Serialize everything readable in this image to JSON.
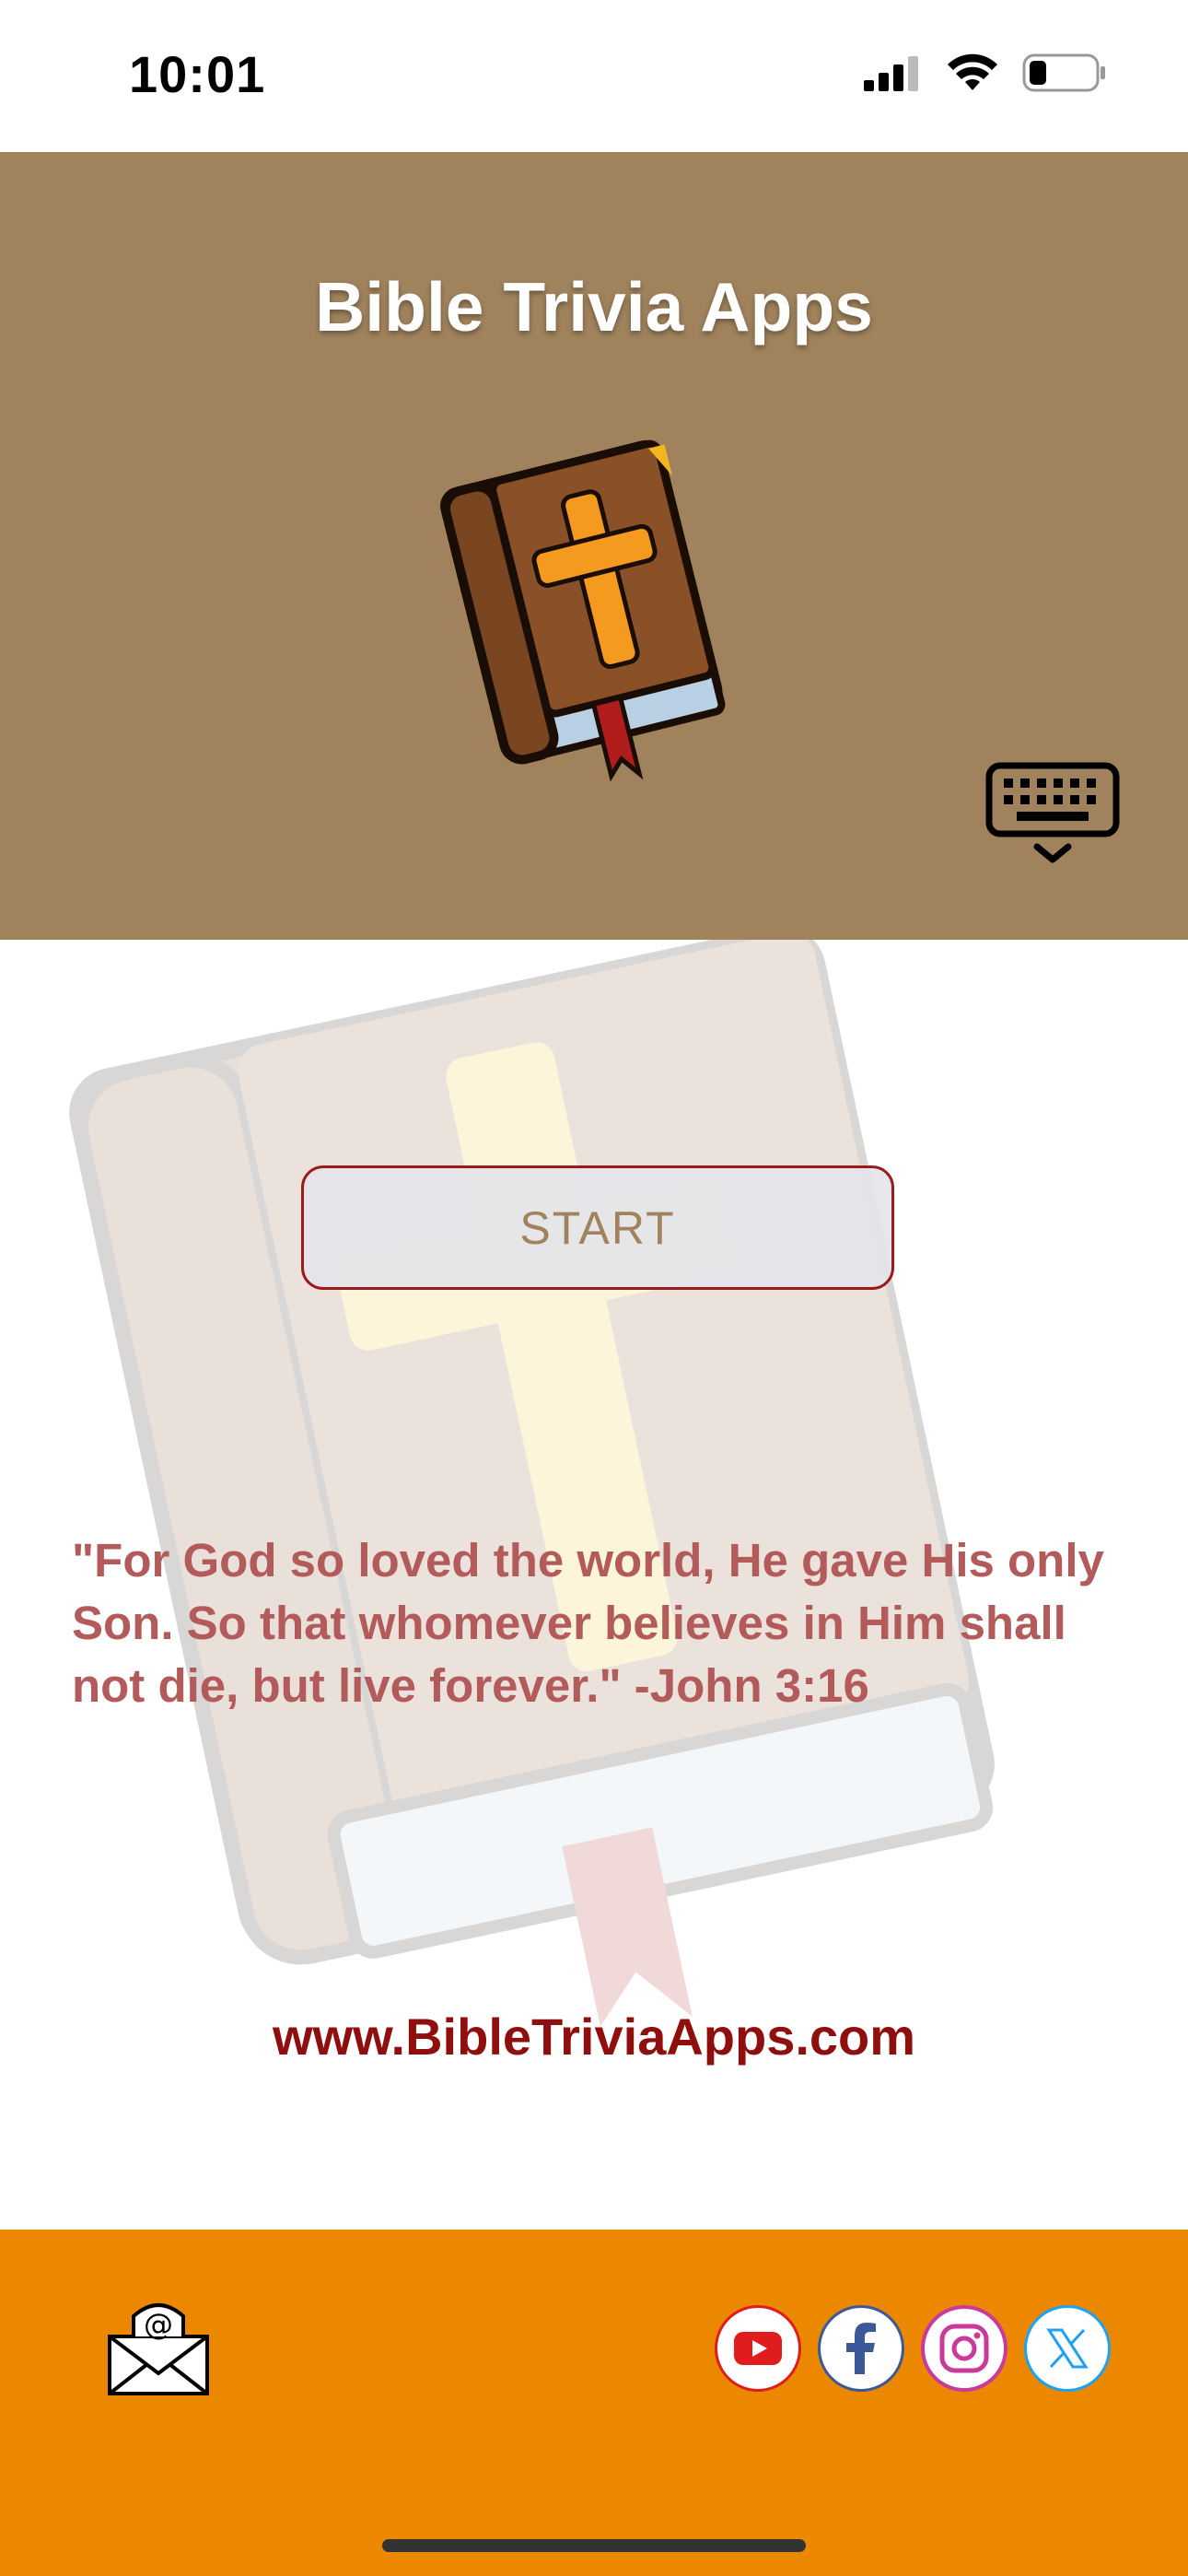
{
  "status_bar": {
    "time": "10:01",
    "battery_level": 0.2
  },
  "header": {
    "title": "Bible Trivia Apps",
    "background": "#a0835d"
  },
  "main": {
    "start_label": "START",
    "verse": "\"For God so loved the world, He gave His only Son. So that whomever believes in Him shall not die, but live forever.\" -John 3:16",
    "website": "www.BibleTriviaApps.com"
  },
  "footer": {
    "background": "#ec8800",
    "icons": [
      "email-icon",
      "youtube-icon",
      "facebook-icon",
      "instagram-icon",
      "x-icon"
    ]
  },
  "colors": {
    "accent_red": "#8f0f0f",
    "verse_color": "#b35a5a",
    "button_text": "#a0835d"
  }
}
